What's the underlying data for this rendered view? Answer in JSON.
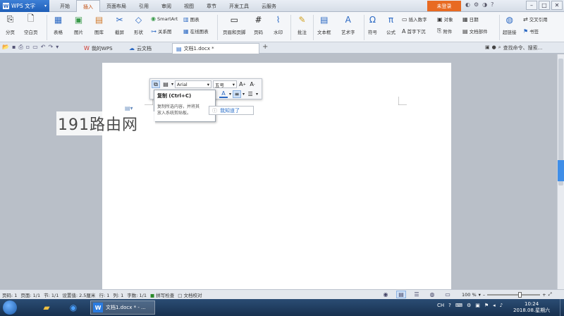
{
  "app": {
    "name": "WPS 文字",
    "login_label": "未登录"
  },
  "menu": [
    "开始",
    "插入",
    "页面布局",
    "引用",
    "审阅",
    "视图",
    "章节",
    "开发工具",
    "云服务"
  ],
  "menu_active_index": 1,
  "ribbon": {
    "pagination": "分页",
    "blank_page": "空白页",
    "table": "表格",
    "picture": "图片",
    "gallery": "图库",
    "screenshot": "截屏",
    "shapes": "形状",
    "smartart": "SmartArt",
    "chart": "图表",
    "relation_map": "关系图",
    "online_chart": "在线图表",
    "header_footer": "页眉和页脚",
    "page_number": "页码",
    "watermark": "水印",
    "comment": "批注",
    "textbox": "文本框",
    "wordart": "艺术字",
    "symbol": "符号",
    "formula": "公式",
    "insert_number": "插入数字",
    "object": "对象",
    "date": "日期",
    "dropcap": "首字下沉",
    "attachment": "附件",
    "doc_parts": "文档部件",
    "hyperlink": "超链接",
    "bookmark": "书签",
    "cross_ref": "交叉引用"
  },
  "doc_tabs": [
    {
      "label": "我的WPS",
      "icon": "wps-icon"
    },
    {
      "label": "云文档",
      "icon": "cloud-icon"
    },
    {
      "label": "文档1.docx *",
      "icon": "document-icon"
    }
  ],
  "search_cmd": "查找命令、搜索...",
  "minibar": {
    "font_name": "Arial",
    "font_size": "五号"
  },
  "tooltip": {
    "title": "复制 (Ctrl+C)",
    "desc_line1": "复制所选内容，并将其",
    "desc_line2": "放入系统剪贴板。"
  },
  "know_it": "我知道了",
  "watermark_text": "191路由网",
  "statusbar": {
    "page": "页码: 1",
    "pages": "页面: 1/1",
    "section": "节: 1/1",
    "setting": "设置值: 2.5厘米",
    "row": "行: 1",
    "col": "列: 1",
    "words": "字数: 1/1",
    "spell": "拼写检查",
    "proof": "文档校对",
    "zoom": "100 %"
  },
  "taskbar": {
    "task_label": "文档1.docx * - ...",
    "ime": "CH",
    "time": "10:24",
    "date": "2018.08.星期六"
  },
  "colors": {
    "login": "#e86a22",
    "accent": "#2a68c3"
  }
}
